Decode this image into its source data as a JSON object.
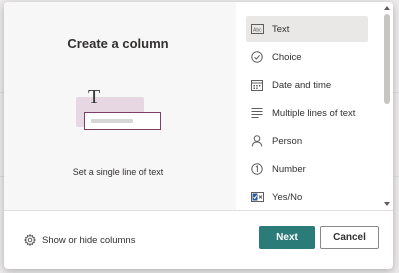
{
  "dialog": {
    "title": "Create a column",
    "description": "Set a single line of text",
    "illustration_letter": "T"
  },
  "column_types": [
    {
      "label": "Text",
      "icon": "text-icon",
      "selected": true
    },
    {
      "label": "Choice",
      "icon": "choice-icon",
      "selected": false
    },
    {
      "label": "Date and time",
      "icon": "calendar-icon",
      "selected": false
    },
    {
      "label": "Multiple lines of text",
      "icon": "multiline-text-icon",
      "selected": false
    },
    {
      "label": "Person",
      "icon": "person-icon",
      "selected": false
    },
    {
      "label": "Number",
      "icon": "number-icon",
      "selected": false
    },
    {
      "label": "Yes/No",
      "icon": "yes-no-icon",
      "selected": false
    }
  ],
  "footer": {
    "show_hide_label": "Show or hide columns",
    "next_label": "Next",
    "cancel_label": "Cancel"
  },
  "colors": {
    "accent": "#2b7b78",
    "illustration_field_border": "#7b3d6a",
    "illustration_bg": "#e6d7e2",
    "selected_item_bg": "#e9e8e7"
  }
}
